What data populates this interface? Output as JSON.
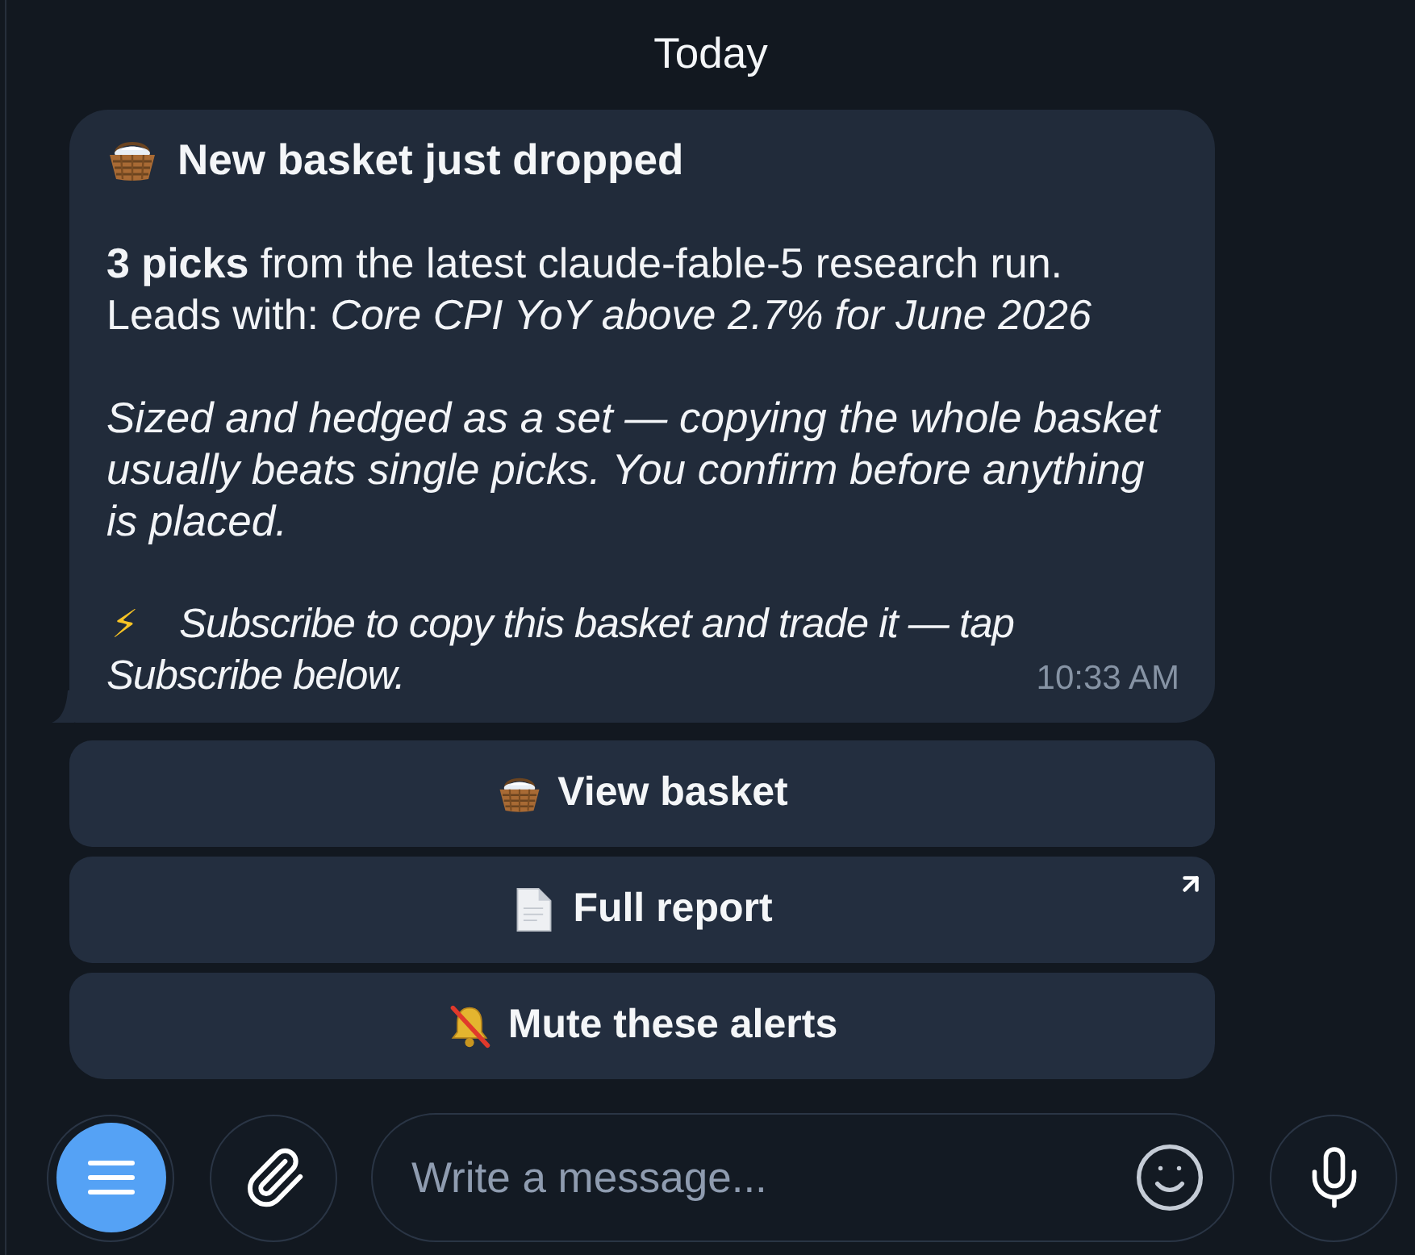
{
  "date_divider": "Today",
  "message": {
    "title": {
      "kind": "basket",
      "text": "New basket just dropped"
    },
    "paragraphs": [
      {
        "text": "**3 picks** from the latest claude-fable-5 research run.\nLeads with: *Core CPI YoY above 2.7% for June 2026*",
        "italic": false
      },
      {
        "text": "Sized and hedged as a set — copying the whole basket usually beats single picks. You confirm before anything is placed.",
        "italic": true
      },
      {
        "lead": "⚡",
        "text": "Subscribe to copy this basket and trade it — tap Subscribe below.",
        "italic": true
      }
    ],
    "time": "10:33 AM"
  },
  "buttons": [
    {
      "kind": "basket",
      "label": "View basket",
      "external": false
    },
    {
      "kind": "document",
      "label": "Full report",
      "external": true
    },
    {
      "kind": "bell_off",
      "label": "Mute these alerts",
      "external": false
    }
  ],
  "composer": {
    "placeholder": "Write a message..."
  }
}
